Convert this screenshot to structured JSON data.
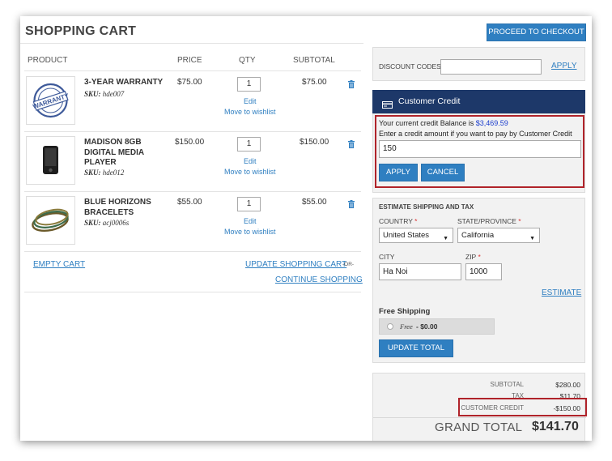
{
  "page": {
    "title": "SHOPPING CART"
  },
  "header": {
    "proceed_label": "PROCEED TO CHECKOUT"
  },
  "table": {
    "columns": {
      "product": "PRODUCT",
      "price": "PRICE",
      "qty": "QTY",
      "subtotal": "SUBTOTAL"
    },
    "rows": [
      {
        "name": "3-YEAR WARRANTY",
        "sku_label": "SKU:",
        "sku": "hde007",
        "price": "$75.00",
        "qty": "1",
        "subtotal": "$75.00",
        "edit": "Edit",
        "wishlist": "Move to wishlist",
        "icon": "warranty-stamp-image"
      },
      {
        "name": "MADISON 8GB DIGITAL MEDIA PLAYER",
        "sku_label": "SKU:",
        "sku": "hde012",
        "price": "$150.00",
        "qty": "1",
        "subtotal": "$150.00",
        "edit": "Edit",
        "wishlist": "Move to wishlist",
        "icon": "media-player-image"
      },
      {
        "name": "BLUE HORIZONS BRACELETS",
        "sku_label": "SKU:",
        "sku": "acj0006s",
        "price": "$55.00",
        "qty": "1",
        "subtotal": "$55.00",
        "edit": "Edit",
        "wishlist": "Move to wishlist",
        "icon": "bracelets-image"
      }
    ]
  },
  "actions": {
    "empty_cart": "EMPTY CART",
    "update_cart": "UPDATE SHOPPING CART",
    "or": "-OR-",
    "continue": "CONTINUE SHOPPING"
  },
  "discount": {
    "label": "DISCOUNT CODES",
    "value": "",
    "apply": "APPLY"
  },
  "credit": {
    "header": "Customer Credit",
    "balance_text": "Your current credit Balance is",
    "balance_value": "$3,469.59",
    "prompt": "Enter a credit amount if you want to pay by Customer Credit",
    "amount": "150",
    "apply": "APPLY",
    "cancel": "CANCEL"
  },
  "shipping": {
    "title": "ESTIMATE SHIPPING AND TAX",
    "country_label": "COUNTRY",
    "country_value": "United States",
    "state_label": "STATE/PROVINCE",
    "state_value": "California",
    "city_label": "CITY",
    "city_value": "Ha Noi",
    "zip_label": "ZIP",
    "zip_value": "1000",
    "required_mark": "*",
    "estimate": "ESTIMATE",
    "method_title": "Free Shipping",
    "method_option_name": "Free",
    "method_option_price": "- $0.00",
    "update_total": "UPDATE TOTAL"
  },
  "totals": {
    "subtotal_label": "SUBTOTAL",
    "subtotal_value": "$280.00",
    "tax_label": "TAX",
    "tax_value": "$11.70",
    "credit_label": "CUSTOMER CREDIT",
    "credit_value": "-$150.00",
    "grand_label": "GRAND TOTAL",
    "grand_value": "$141.70"
  },
  "colors": {
    "accent": "#2f7fc1",
    "navy_header": "#1d3869",
    "highlight_border": "#b0232a"
  }
}
